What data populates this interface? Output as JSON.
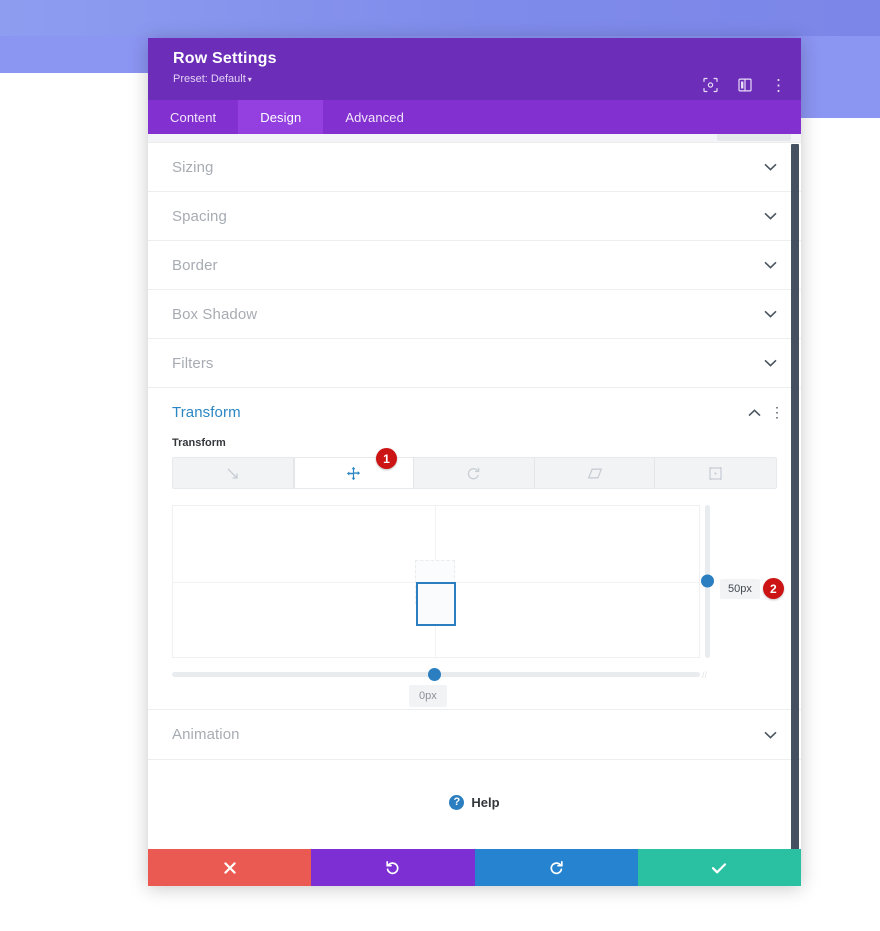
{
  "window": {
    "title": "Row Settings",
    "preset_label": "Preset: Default",
    "preset_caret": "▾",
    "header_icons": [
      {
        "name": "focus-target-icon",
        "glyph": "⦿"
      },
      {
        "name": "layout-panel-icon",
        "glyph": "▯"
      },
      {
        "name": "more-options-icon",
        "glyph": "⋮"
      }
    ]
  },
  "tabs": [
    {
      "label": "Content",
      "active": false
    },
    {
      "label": "Design",
      "active": true
    },
    {
      "label": "Advanced",
      "active": false
    }
  ],
  "accordion": {
    "sections_above": [
      {
        "label": "Sizing",
        "chevron": "⌄"
      },
      {
        "label": "Spacing",
        "chevron": "⌄"
      },
      {
        "label": "Border",
        "chevron": "⌄"
      },
      {
        "label": "Box Shadow",
        "chevron": "⌄"
      },
      {
        "label": "Filters",
        "chevron": "⌄"
      }
    ],
    "sections_below": [
      {
        "label": "Animation",
        "chevron": "⌄"
      }
    ]
  },
  "transform": {
    "section_title": "Transform",
    "collapse_chevron": "⌃",
    "options_glyph": "⋮",
    "field_label": "Transform",
    "modes": [
      {
        "name": "scale-mode",
        "glyph": "⇲",
        "active": false
      },
      {
        "name": "translate-mode",
        "glyph": "✛",
        "active": true
      },
      {
        "name": "rotate-mode",
        "glyph": "↻",
        "active": false
      },
      {
        "name": "skew-mode",
        "glyph": "▱",
        "active": false
      },
      {
        "name": "origin-mode",
        "glyph": "⛶",
        "active": false
      }
    ],
    "vertical_value": "50px",
    "horizontal_value": "0px",
    "step_badges": [
      {
        "number": "1"
      },
      {
        "number": "2"
      }
    ]
  },
  "help": {
    "icon_glyph": "?",
    "label": "Help"
  },
  "footer": {
    "buttons": [
      {
        "name": "cancel-button",
        "glyph": "✖",
        "color": "#ea5a52"
      },
      {
        "name": "undo-button",
        "glyph": "↺",
        "color": "#7e2fd4"
      },
      {
        "name": "redo-button",
        "glyph": "↻",
        "color": "#2683cf"
      },
      {
        "name": "save-button",
        "glyph": "✔",
        "color": "#2ac1a3"
      }
    ]
  },
  "colors": {
    "header_purple": "#6c2eb9",
    "tabbar_purple": "#8230cf",
    "tab_active": "#9440e0",
    "accent_blue": "#2b7fc0",
    "badge_red": "#cc1414",
    "backdrop_blue": "#8b95f2"
  }
}
